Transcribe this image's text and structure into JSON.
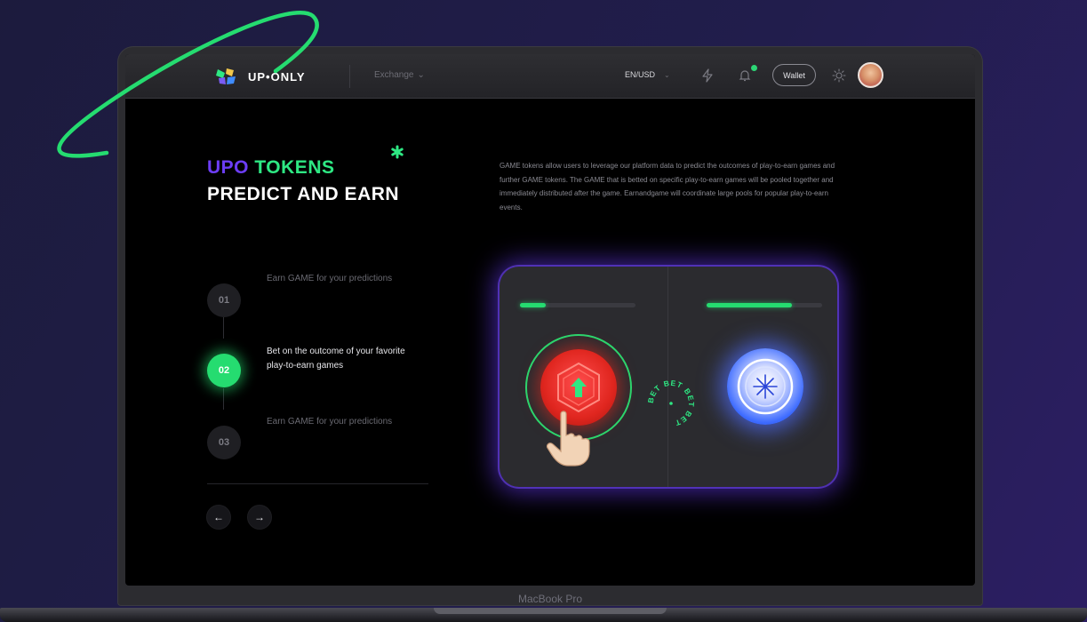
{
  "nav": {
    "logo_text": "UP•ONLY",
    "exchange_label": "Exchange",
    "currency_label": "EN/USD",
    "wallet_label": "Wallet"
  },
  "hero": {
    "title_part1": "UPO",
    "title_part2": "TOKENS",
    "title_line2": "PREDICT AND EARN",
    "description": "GAME tokens allow users to leverage our platform data to predict the outcomes of play-to-earn games and further GAME tokens. The GAME that is betted on specific play-to-earn games will be pooled together and immediately distributed after the game. Earnandgame will coordinate large pools for popular play-to-earn events."
  },
  "steps": [
    {
      "number": "01",
      "text": "Earn GAME for your predictions",
      "active": false
    },
    {
      "number": "02",
      "text": "Bet on the outcome of your favorite play-to-earn games",
      "active": true
    },
    {
      "number": "03",
      "text": "Earn GAME for your predictions",
      "active": false
    }
  ],
  "nav_arrows": {
    "prev": "←",
    "next": "→"
  },
  "game": {
    "left_bar_progress": 0.22,
    "right_bar_progress": 0.74,
    "bet_text": "BET BET BET BET"
  },
  "device_label": "MacBook Pro",
  "colors": {
    "accent_green": "#25dc70",
    "accent_purple": "#6c3df5",
    "card_glow": "#6a3cff"
  },
  "icons": {
    "logo": "uponly-logo-icon",
    "exchange_chevron": "chevron-down-icon",
    "currency_chevron": "chevron-down-icon",
    "lightning": "lightning-icon",
    "bell": "bell-icon",
    "sun": "sun-icon",
    "asterisk": "asterisk-icon",
    "hand": "pointing-hand-icon"
  }
}
